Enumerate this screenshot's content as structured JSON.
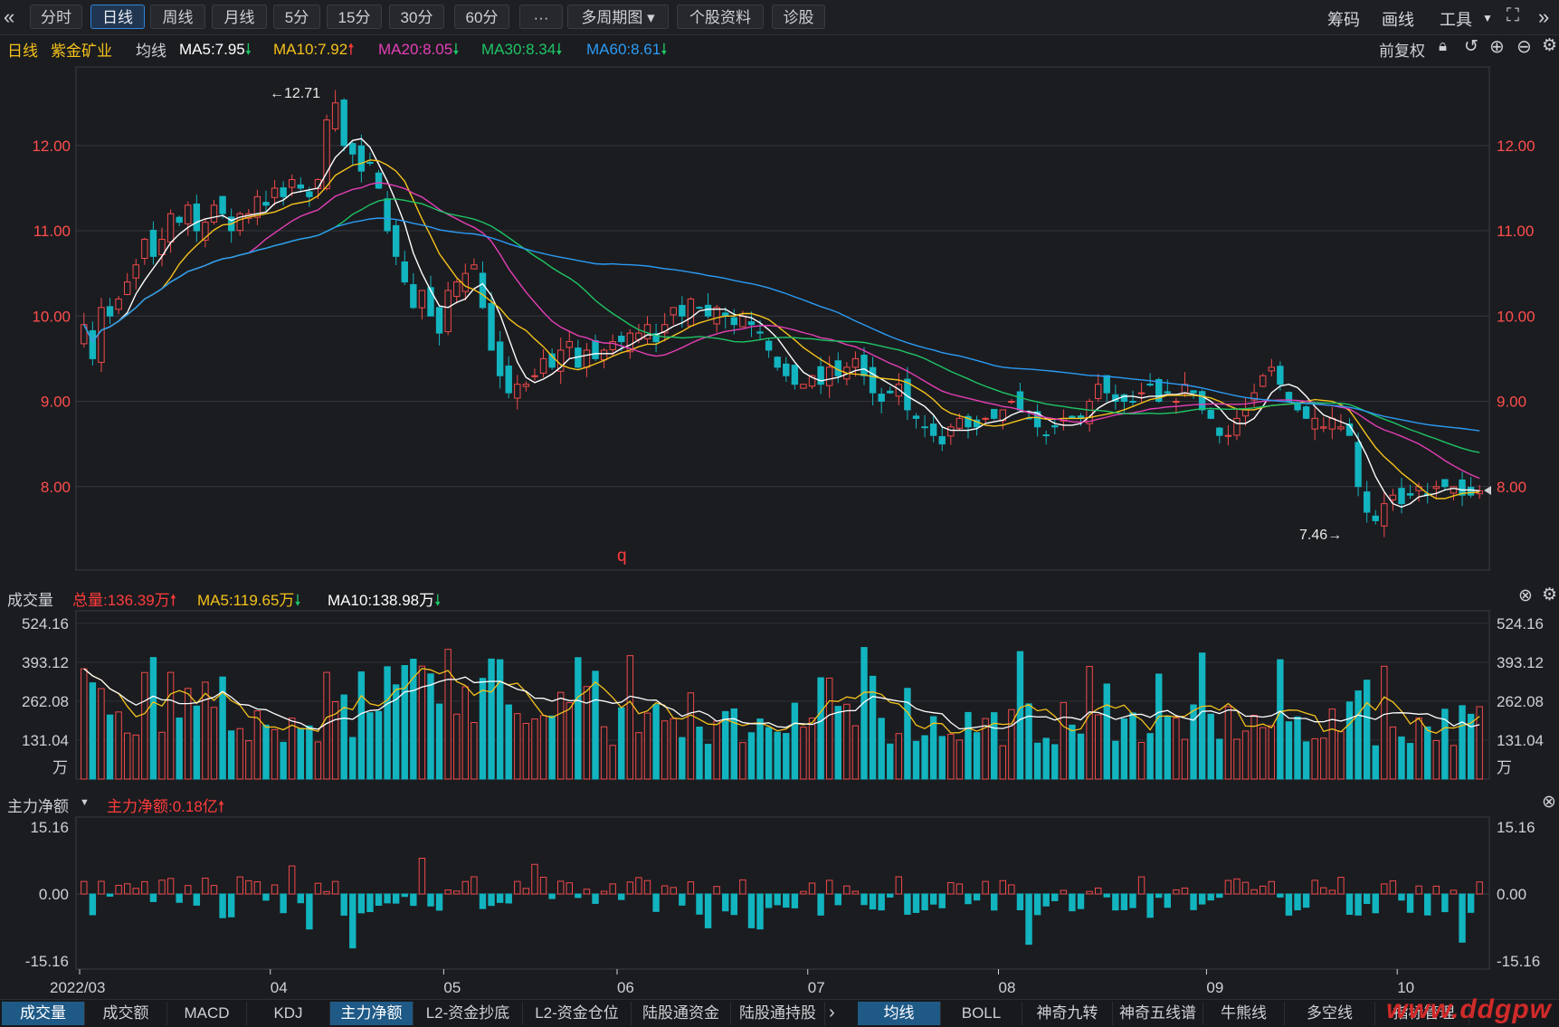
{
  "toolbar": {
    "back_icon": "double-chevron-left-icon",
    "tabs": [
      "分时",
      "日线",
      "周线",
      "月线",
      "5分",
      "15分",
      "30分",
      "60分",
      "···",
      "多周期图",
      "个股资料",
      "诊股"
    ],
    "active_tab": "日线",
    "right_items": [
      "筹码",
      "画线",
      "工具"
    ],
    "expand_icon": "fullscreen-icon",
    "more_icon": "double-chevron-right-icon"
  },
  "ma_bar": {
    "period": "日线",
    "stock": "紫金矿业",
    "ma_label": "均线",
    "ma5": "MA5:7.95",
    "ma10": "MA10:7.92",
    "ma20": "MA20:8.05",
    "ma30": "MA30:8.34",
    "ma60": "MA60:8.61",
    "adjust": "前复权",
    "colors": {
      "ma5": "#ffffff",
      "ma10": "#f4c21b",
      "ma20": "#e53fb6",
      "ma30": "#1ec465",
      "ma60": "#2b9bf4"
    }
  },
  "volume_hdr": {
    "title": "成交量",
    "total": "总量:136.39万",
    "ma5": "MA5:119.65万",
    "ma10": "MA10:138.98万"
  },
  "flow_hdr": {
    "title": "主力净额",
    "value": "主力净额:0.18亿"
  },
  "chart_data": [
    {
      "type": "candlestick",
      "title": "紫金矿业 日线",
      "ylim": [
        7.0,
        12.9
      ],
      "yticks": [
        "12.00",
        "11.00",
        "10.00",
        "9.00",
        "8.00"
      ],
      "high_label": "12.71",
      "low_label": "7.46",
      "annotation": "q",
      "last_price_marker": "8.00",
      "x_labels": [
        "2022/03",
        "04",
        "05",
        "06",
        "07",
        "08",
        "09",
        "10"
      ],
      "closes": [
        9.9,
        9.5,
        10.1,
        10.0,
        10.2,
        10.4,
        10.6,
        10.9,
        10.7,
        10.9,
        11.2,
        11.1,
        11.3,
        11.0,
        11.1,
        11.3,
        11.2,
        11.0,
        11.2,
        11.2,
        11.4,
        11.3,
        11.5,
        11.4,
        11.6,
        11.5,
        11.4,
        11.6,
        12.3,
        12.5,
        12.0,
        11.9,
        11.7,
        11.8,
        11.5,
        11.0,
        10.7,
        10.4,
        10.1,
        10.3,
        10.0,
        9.8,
        10.3,
        10.4,
        10.5,
        10.6,
        10.1,
        9.6,
        9.3,
        9.1,
        9.2,
        9.2,
        9.3,
        9.5,
        9.4,
        9.6,
        9.7,
        9.4,
        9.6,
        9.5,
        9.6,
        9.7,
        9.7,
        9.8,
        9.8,
        9.9,
        9.7,
        9.9,
        10.1,
        10.0,
        10.2,
        10.1,
        10.0,
        10.1,
        10.0,
        9.9,
        10.0,
        9.9,
        9.8,
        9.6,
        9.4,
        9.3,
        9.2,
        9.2,
        9.3,
        9.2,
        9.4,
        9.3,
        9.4,
        9.5,
        9.3,
        9.1,
        9.0,
        9.1,
        9.2,
        8.9,
        8.8,
        8.7,
        8.6,
        8.5,
        8.7,
        8.8,
        8.7,
        8.7,
        8.8,
        8.8,
        8.9,
        9.0,
        8.9,
        8.8,
        8.7,
        8.6,
        8.7,
        8.8,
        8.8,
        8.8,
        9.0,
        9.2,
        9.1,
        9.0,
        9.0,
        9.0,
        9.1,
        9.2,
        9.0,
        9.1,
        9.0,
        9.2,
        9.1,
        8.9,
        8.8,
        8.6,
        8.6,
        8.8,
        8.9,
        9.1,
        9.3,
        9.4,
        9.2,
        9.0,
        8.9,
        8.8,
        8.8,
        8.7,
        8.8,
        8.7,
        8.6,
        8.0,
        7.7,
        7.6,
        7.8,
        7.9,
        7.8,
        7.9,
        8.0,
        7.9,
        8.0,
        8.0,
        8.0,
        7.9,
        7.9,
        7.95
      ]
    },
    {
      "type": "bar",
      "title": "成交量",
      "unit": "万",
      "yticks": [
        "524.16",
        "393.12",
        "262.08",
        "131.04"
      ],
      "ylim": [
        0,
        560
      ]
    },
    {
      "type": "bar",
      "title": "主力净额",
      "yticks": [
        "15.16",
        "0.00",
        "-15.16"
      ],
      "ylim": [
        -17,
        17
      ]
    }
  ],
  "bottom_tabs_left": [
    "成交量",
    "成交额",
    "MACD",
    "KDJ",
    "主力净额",
    "L2-资金抄底",
    "L2-资金仓位",
    "陆股通资金",
    "陆股通持股"
  ],
  "bottom_tabs_right": [
    "均线",
    "BOLL",
    "神奇九转",
    "神奇五线谱",
    "牛熊线",
    "多空线",
    "指标管理"
  ],
  "bottom_active_left": [
    "成交量",
    "主力净额"
  ],
  "bottom_active_right": "均线",
  "watermark": "www.ddgpw"
}
